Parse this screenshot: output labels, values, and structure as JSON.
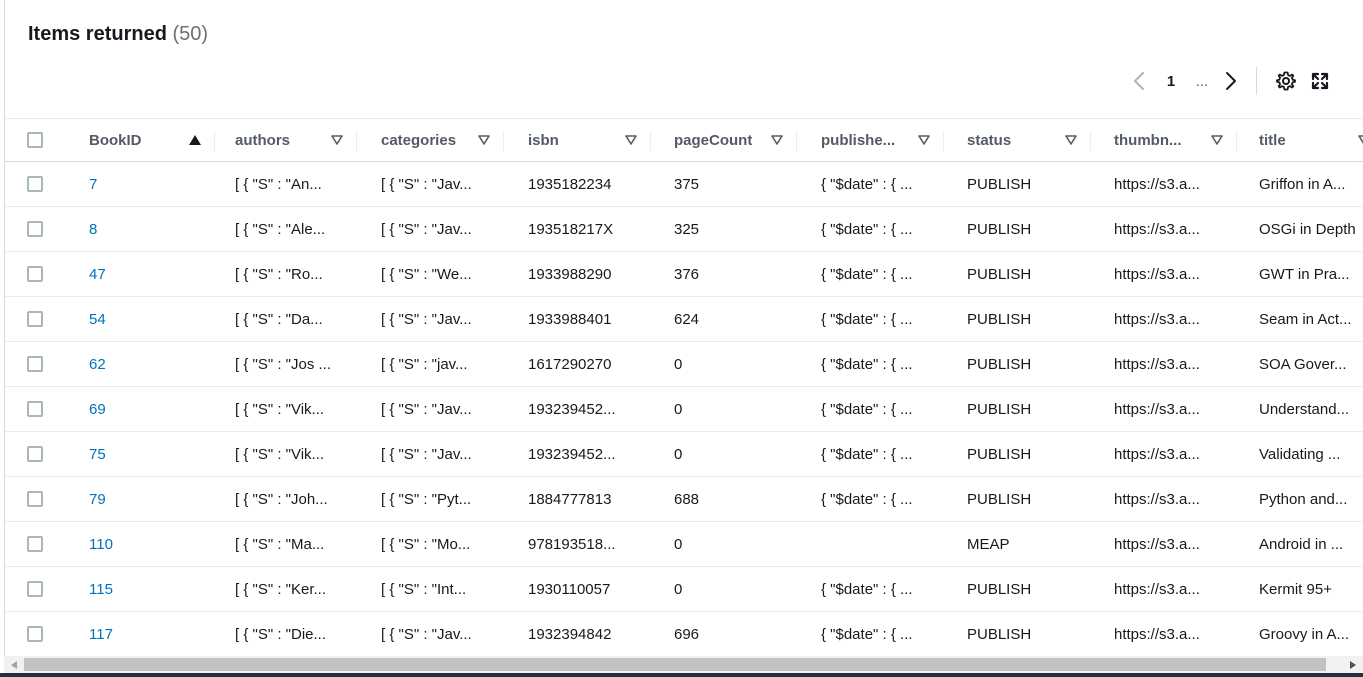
{
  "header": {
    "title": "Items returned",
    "count": "(50)"
  },
  "pagination": {
    "current_page": "1",
    "ellipsis": "..."
  },
  "icons": {
    "prev": "chevron-left-icon",
    "next": "chevron-right-icon",
    "settings": "gear-icon",
    "fullscreen": "expand-icon",
    "sort": "sort-ascending-icon",
    "filter": "filter-icon"
  },
  "columns": {
    "bookid": "BookID",
    "authors": "authors",
    "categories": "categories",
    "isbn": "isbn",
    "pagecount": "pageCount",
    "publisheddate": "publishe...",
    "status": "status",
    "thumbnail": "thumbn...",
    "title": "title"
  },
  "rows": [
    {
      "bookid": "7",
      "authors": "[ { \"S\" : \"An...",
      "categories": "[ { \"S\" : \"Jav...",
      "isbn": "1935182234",
      "pagecount": "375",
      "publisheddate": "{ \"$date\" : { ...",
      "status": "PUBLISH",
      "thumbnail": "https://s3.a...",
      "title": "Griffon in A..."
    },
    {
      "bookid": "8",
      "authors": "[ { \"S\" : \"Ale...",
      "categories": "[ { \"S\" : \"Jav...",
      "isbn": "193518217X",
      "pagecount": "325",
      "publisheddate": "{ \"$date\" : { ...",
      "status": "PUBLISH",
      "thumbnail": "https://s3.a...",
      "title": "OSGi in Depth"
    },
    {
      "bookid": "47",
      "authors": "[ { \"S\" : \"Ro...",
      "categories": "[ { \"S\" : \"We...",
      "isbn": "1933988290",
      "pagecount": "376",
      "publisheddate": "{ \"$date\" : { ...",
      "status": "PUBLISH",
      "thumbnail": "https://s3.a...",
      "title": "GWT in Pra..."
    },
    {
      "bookid": "54",
      "authors": "[ { \"S\" : \"Da...",
      "categories": "[ { \"S\" : \"Jav...",
      "isbn": "1933988401",
      "pagecount": "624",
      "publisheddate": "{ \"$date\" : { ...",
      "status": "PUBLISH",
      "thumbnail": "https://s3.a...",
      "title": "Seam in Act..."
    },
    {
      "bookid": "62",
      "authors": "[ { \"S\" : \"Jos ...",
      "categories": "[ { \"S\" : \"jav...",
      "isbn": "1617290270",
      "pagecount": "0",
      "publisheddate": "{ \"$date\" : { ...",
      "status": "PUBLISH",
      "thumbnail": "https://s3.a...",
      "title": "SOA Gover..."
    },
    {
      "bookid": "69",
      "authors": "[ { \"S\" : \"Vik...",
      "categories": "[ { \"S\" : \"Jav...",
      "isbn": "193239452...",
      "pagecount": "0",
      "publisheddate": "{ \"$date\" : { ...",
      "status": "PUBLISH",
      "thumbnail": "https://s3.a...",
      "title": "Understand..."
    },
    {
      "bookid": "75",
      "authors": "[ { \"S\" : \"Vik...",
      "categories": "[ { \"S\" : \"Jav...",
      "isbn": "193239452...",
      "pagecount": "0",
      "publisheddate": "{ \"$date\" : { ...",
      "status": "PUBLISH",
      "thumbnail": "https://s3.a...",
      "title": "Validating ..."
    },
    {
      "bookid": "79",
      "authors": "[ { \"S\" : \"Joh...",
      "categories": "[ { \"S\" : \"Pyt...",
      "isbn": "1884777813",
      "pagecount": "688",
      "publisheddate": "{ \"$date\" : { ...",
      "status": "PUBLISH",
      "thumbnail": "https://s3.a...",
      "title": "Python and..."
    },
    {
      "bookid": "110",
      "authors": "[ { \"S\" : \"Ma...",
      "categories": "[ { \"S\" : \"Mo...",
      "isbn": "978193518...",
      "pagecount": "0",
      "publisheddate": "",
      "status": "MEAP",
      "thumbnail": "https://s3.a...",
      "title": "Android in ..."
    },
    {
      "bookid": "115",
      "authors": "[ { \"S\" : \"Ker...",
      "categories": "[ { \"S\" : \"Int...",
      "isbn": "1930110057",
      "pagecount": "0",
      "publisheddate": "{ \"$date\" : { ...",
      "status": "PUBLISH",
      "thumbnail": "https://s3.a...",
      "title": "Kermit 95+"
    },
    {
      "bookid": "117",
      "authors": "[ { \"S\" : \"Die...",
      "categories": "[ { \"S\" : \"Jav...",
      "isbn": "1932394842",
      "pagecount": "696",
      "publisheddate": "{ \"$date\" : { ...",
      "status": "PUBLISH",
      "thumbnail": "https://s3.a...",
      "title": "Groovy in A..."
    }
  ]
}
